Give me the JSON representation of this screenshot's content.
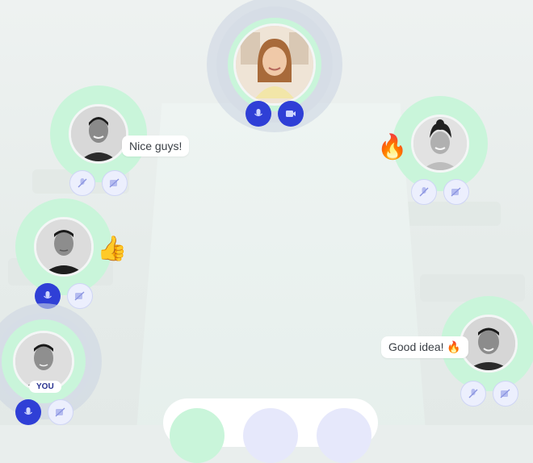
{
  "participants": [
    {
      "id": "host",
      "mic": "on",
      "video": "on"
    },
    {
      "id": "p-left-top",
      "mic": "off",
      "video": "off",
      "message": "Nice guys!"
    },
    {
      "id": "p-right-top",
      "mic": "off",
      "video": "off",
      "reaction": "🔥"
    },
    {
      "id": "p-left-mid",
      "mic": "on",
      "video": "off",
      "reaction": "👍"
    },
    {
      "id": "p-you",
      "mic": "on",
      "video": "off",
      "badge": "YOU"
    },
    {
      "id": "p-right-bottom",
      "mic": "off",
      "video": "off",
      "message": "Good idea! 🔥"
    }
  ],
  "colors": {
    "accent": "#2f3fd6",
    "ring": "#c9f5da",
    "muted_button": "#eceffd"
  }
}
